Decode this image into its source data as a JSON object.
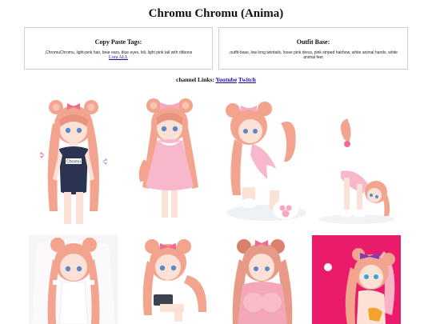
{
  "page_title": "Chromu Chromu (Anima)",
  "copy_paste": {
    "title": "Copy Paste Tags:",
    "text": ",ChromuChromu, light-pink hair, bear ears, blue eyes, loli, light pink tail with ribbons",
    "link": "Lora ALL"
  },
  "outfit_base": {
    "title": "Outfit Base:",
    "text": ",outfit-base, low long twintails, loose pink dress, pink striped hairbow, white animal hands, white animal feet"
  },
  "channel": {
    "label": "channel Links:",
    "youtube": "Youtube",
    "twitch": "Twitch"
  },
  "gallery": [
    {
      "name": "school-swimsuit",
      "swimsuit_text": "Chromu",
      "bg": "#ffffff"
    },
    {
      "name": "pink-dress",
      "bg": "#ffffff"
    },
    {
      "name": "kneeling",
      "bg": "#ffffff"
    },
    {
      "name": "bending-over",
      "bg": "#ffffff"
    },
    {
      "name": "white-dress-veil",
      "bg": "#ffffff"
    },
    {
      "name": "sitting-laptop",
      "bg": "#ffffff"
    },
    {
      "name": "pink-sweater",
      "bg": "#ffffff"
    },
    {
      "name": "magenta-background",
      "bg": "#ea1b6a"
    }
  ],
  "colors": {
    "hair": "#f3a48f",
    "hair_dark": "#d9806f",
    "bow": "#f06b8e",
    "skin": "#fce2d6",
    "eye": "#5c87c9",
    "link": "#1a0dab"
  }
}
